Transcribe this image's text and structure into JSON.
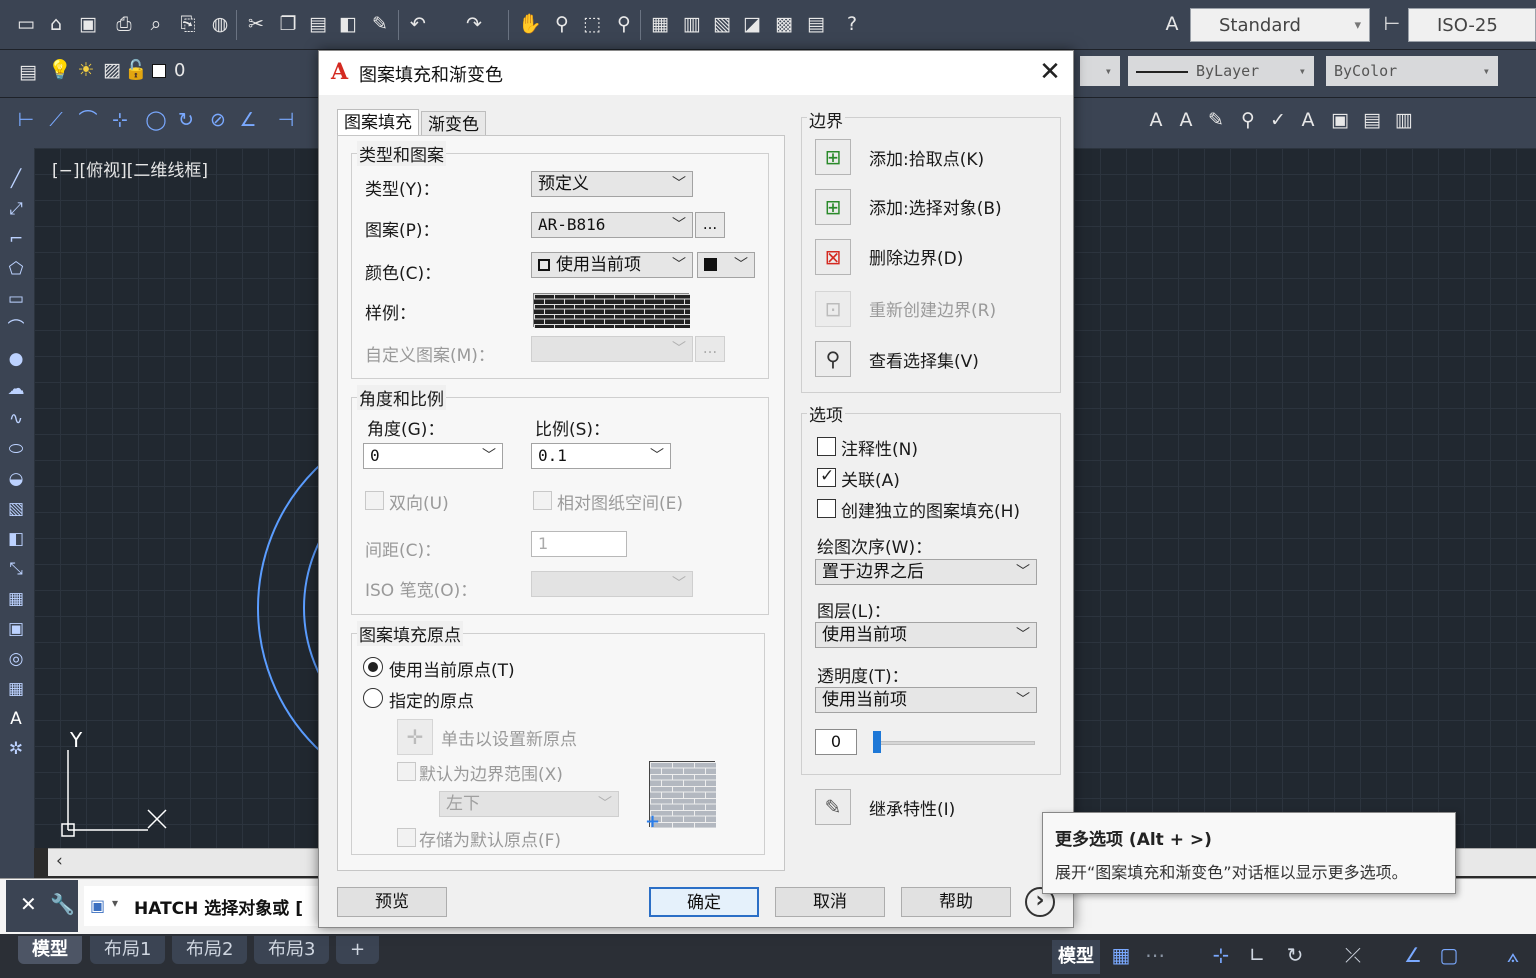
{
  "toolbar": {
    "text_style": "Standard",
    "dim_style": "ISO-25",
    "layer_value": "0",
    "linetype": "ByLayer",
    "color": "ByColor"
  },
  "viewport": {
    "label": "[−][俯视][二维线框]",
    "axis_y": "Y",
    "axis_x": "X"
  },
  "command": {
    "text": "HATCH 选择对象或 ["
  },
  "layouts": {
    "tabs": [
      "模型",
      "布局1",
      "布局2",
      "布局3"
    ],
    "add": "+",
    "model_indicator": "模型"
  },
  "dialog": {
    "title": "图案填充和渐变色",
    "close": "✕",
    "tabs": [
      "图案填充",
      "渐变色"
    ],
    "type_pattern": {
      "title": "类型和图案",
      "type_label": "类型(Y)：",
      "type_value": "预定义",
      "pattern_label": "图案(P)：",
      "pattern_value": "AR-B816",
      "browse": "...",
      "color_label": "颜色(C)：",
      "color_value": "使用当前项",
      "swatch_label": "样例：",
      "custom_label": "自定义图案(M)：",
      "custom_browse": "..."
    },
    "angle_scale": {
      "title": "角度和比例",
      "angle_label": "角度(G)：",
      "angle_value": "0",
      "scale_label": "比例(S)：",
      "scale_value": "0.1",
      "double_label": "双向(U)",
      "relative_label": "相对图纸空间(E)",
      "spacing_label": "间距(C)：",
      "spacing_value": "1",
      "iso_label": "ISO 笔宽(O)："
    },
    "origin": {
      "title": "图案填充原点",
      "use_current": "使用当前原点(T)",
      "specified": "指定的原点",
      "click_set": "单击以设置新原点",
      "default_extent": "默认为边界范围(X)",
      "position_value": "左下",
      "store_default": "存储为默认原点(F)"
    },
    "boundary": {
      "title": "边界",
      "add_pick": "添加:拾取点(K)",
      "add_select": "添加:选择对象(B)",
      "remove": "删除边界(D)",
      "recreate": "重新创建边界(R)",
      "view": "查看选择集(V)"
    },
    "options": {
      "title": "选项",
      "annotative": "注释性(N)",
      "associative": "关联(A)",
      "separate": "创建独立的图案填充(H)",
      "draw_order_label": "绘图次序(W)：",
      "draw_order_value": "置于边界之后",
      "layer_label": "图层(L)：",
      "layer_value": "使用当前项",
      "transparency_label": "透明度(T)：",
      "transparency_value": "使用当前项",
      "transparency_number": "0"
    },
    "inherit": "继承特性(I)",
    "buttons": {
      "preview": "预览",
      "ok": "确定",
      "cancel": "取消",
      "help": "帮助",
      "more": "›"
    }
  },
  "tooltip": {
    "title": "更多选项 (Alt + >)",
    "body": "展开“图案填充和渐变色”对话框以显示更多选项。"
  }
}
